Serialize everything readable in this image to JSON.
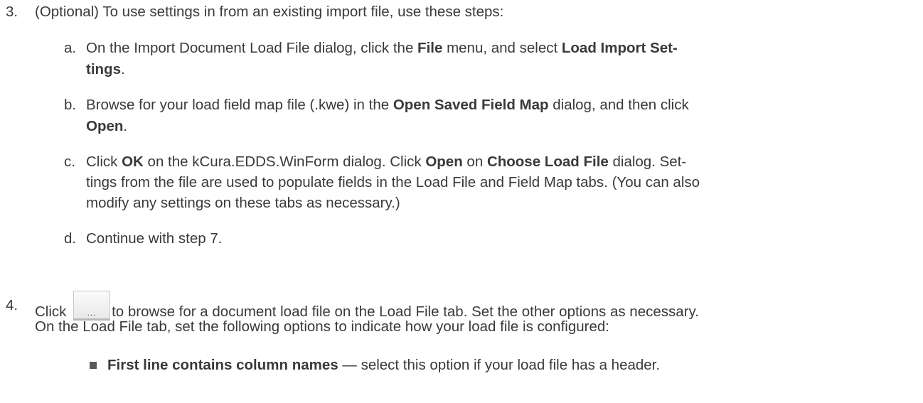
{
  "step3": {
    "number": "3.",
    "text": "(Optional) To use settings in from an existing import file, use these steps:",
    "substeps": {
      "a": {
        "letter": "a.",
        "t1": "On the Import Document Load File dialog, click the ",
        "b1": "File",
        "t2": " menu, and select ",
        "b2": "Load Import Set-",
        "b3": "tings",
        "t3": "."
      },
      "b": {
        "letter": "b.",
        "t1": "Browse for your load field map file (.kwe) in the ",
        "b1": "Open Saved Field Map",
        "t2": " dialog, and then click",
        "b2": "Open",
        "t3": "."
      },
      "c": {
        "letter": "c.",
        "t1": "Click ",
        "b1": "OK",
        "t2": " on the kCura.EDDS.WinForm dialog. Click ",
        "b2": "Open",
        "t3": " on ",
        "b3": "Choose Load File",
        "t4": " dialog. Set-",
        "line2": "tings from the file are used to populate fields in the Load File and Field Map tabs. (You can also",
        "line3": "modify any settings on these tabs as necessary.)"
      },
      "d": {
        "letter": "d.",
        "text": "Continue with step 7."
      }
    }
  },
  "step4": {
    "number": "4.",
    "t1": "Click ",
    "button_label": "...",
    "t2": "to browse for a document load file on the Load File tab. Set the other options as necessary.",
    "line2": "On the Load File tab, set the following options to indicate how your load file is configured:",
    "bullet": {
      "bold": "First line contains column names",
      "text": " — select this option if your load file has a header."
    }
  }
}
